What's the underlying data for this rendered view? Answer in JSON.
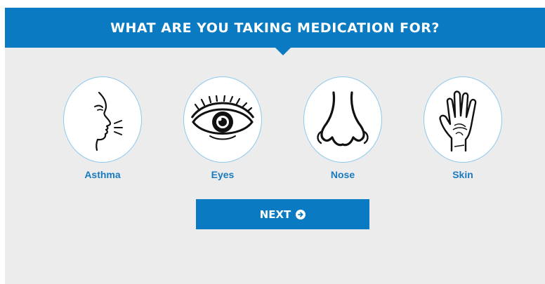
{
  "header": {
    "title": "WHAT ARE YOU TAKING MEDICATION FOR?"
  },
  "options": [
    {
      "label": "Asthma",
      "icon": "asthma-face-icon"
    },
    {
      "label": "Eyes",
      "icon": "eye-icon"
    },
    {
      "label": "Nose",
      "icon": "nose-icon"
    },
    {
      "label": "Skin",
      "icon": "hand-icon"
    }
  ],
  "next_button": {
    "label": "NEXT",
    "icon": "arrow-right-circle-icon"
  },
  "colors": {
    "brand_blue": "#0a7bc2",
    "label_blue": "#1a7ac0",
    "panel_bg": "#ececec",
    "circle_border": "#8fc8ec"
  }
}
